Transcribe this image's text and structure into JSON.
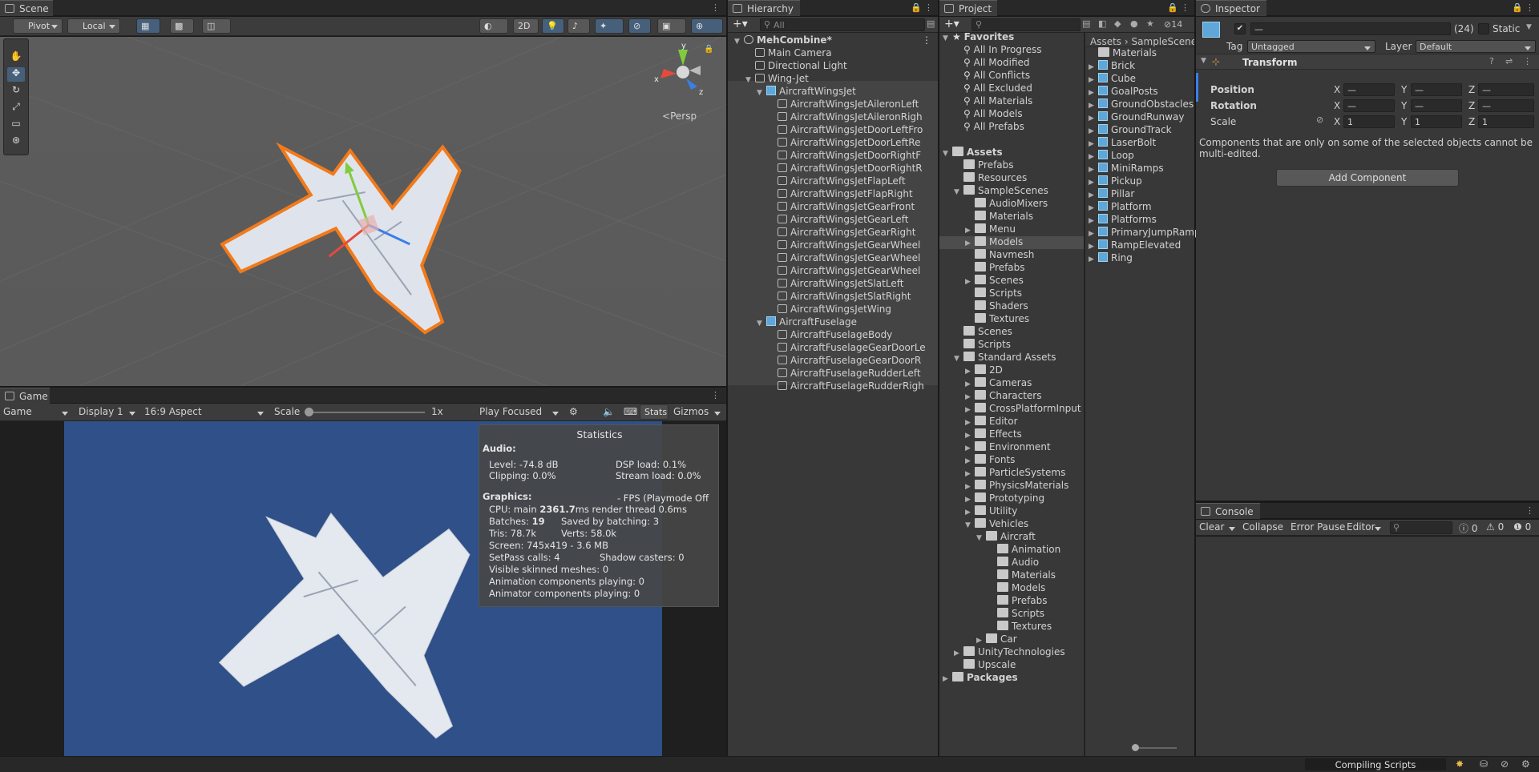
{
  "scene": {
    "tab_label": "Scene",
    "pivot_label": "Pivot",
    "local_label": "Local",
    "mode_2d_label": "2D",
    "persp_label": "Persp",
    "gizmo_axes": {
      "x": "x",
      "y": "y",
      "z": "z"
    }
  },
  "game": {
    "tab_label": "Game",
    "game_dropdown": "Game",
    "display_dropdown": "Display 1",
    "aspect_dropdown": "16:9 Aspect",
    "scale_label": "Scale",
    "scale_value": "1x",
    "play_focused_dropdown": "Play Focused",
    "stats_label": "Stats",
    "gizmos_label": "Gizmos",
    "stats_panel": {
      "title": "Statistics",
      "audio_header": "Audio:",
      "level": "Level: -74.8 dB",
      "clipping": "Clipping: 0.0%",
      "dsp_load": "DSP load: 0.1%",
      "stream_load": "Stream load: 0.0%",
      "graphics_header": "Graphics:",
      "fps": "- FPS (Playmode Off",
      "cpu_prefix": "CPU: main ",
      "cpu_main": "2361.7",
      "cpu_suffix": "ms  render thread 0.6ms",
      "batches_prefix": "Batches: ",
      "batches": "19",
      "saved_batching": "Saved by batching: 3",
      "tris": "Tris: 78.7k",
      "verts": "Verts: 58.0k",
      "screen": "Screen: 745x419 - 3.6 MB",
      "setpass": "SetPass calls: 4",
      "shadow_casters": "Shadow casters: 0",
      "skinned_meshes": "Visible skinned meshes: 0",
      "animation_components": "Animation components playing: 0",
      "animator_components": "Animator components playing: 0"
    }
  },
  "hierarchy": {
    "tab_label": "Hierarchy",
    "search_placeholder": "All",
    "items": [
      {
        "label": "MehCombine*",
        "depth": 0,
        "type": "scene",
        "expanded": true
      },
      {
        "label": "Main Camera",
        "depth": 1,
        "type": "object"
      },
      {
        "label": "Directional Light",
        "depth": 1,
        "type": "object"
      },
      {
        "label": "Wing-Jet",
        "depth": 1,
        "type": "object",
        "expanded": true
      },
      {
        "label": "AircraftWingsJet",
        "depth": 2,
        "type": "prefab",
        "expanded": true
      },
      {
        "label": "AircraftWingsJetAileronLeft",
        "depth": 3,
        "type": "object"
      },
      {
        "label": "AircraftWingsJetAileronRigh",
        "depth": 3,
        "type": "object"
      },
      {
        "label": "AircraftWingsJetDoorLeftFro",
        "depth": 3,
        "type": "object"
      },
      {
        "label": "AircraftWingsJetDoorLeftRe",
        "depth": 3,
        "type": "object"
      },
      {
        "label": "AircraftWingsJetDoorRightF",
        "depth": 3,
        "type": "object"
      },
      {
        "label": "AircraftWingsJetDoorRightR",
        "depth": 3,
        "type": "object"
      },
      {
        "label": "AircraftWingsJetFlapLeft",
        "depth": 3,
        "type": "object"
      },
      {
        "label": "AircraftWingsJetFlapRight",
        "depth": 3,
        "type": "object"
      },
      {
        "label": "AircraftWingsJetGearFront",
        "depth": 3,
        "type": "object"
      },
      {
        "label": "AircraftWingsJetGearLeft",
        "depth": 3,
        "type": "object"
      },
      {
        "label": "AircraftWingsJetGearRight",
        "depth": 3,
        "type": "object"
      },
      {
        "label": "AircraftWingsJetGearWheel",
        "depth": 3,
        "type": "object"
      },
      {
        "label": "AircraftWingsJetGearWheel",
        "depth": 3,
        "type": "object"
      },
      {
        "label": "AircraftWingsJetGearWheel",
        "depth": 3,
        "type": "object"
      },
      {
        "label": "AircraftWingsJetSlatLeft",
        "depth": 3,
        "type": "object"
      },
      {
        "label": "AircraftWingsJetSlatRight",
        "depth": 3,
        "type": "object"
      },
      {
        "label": "AircraftWingsJetWing",
        "depth": 3,
        "type": "object"
      },
      {
        "label": "AircraftFuselage",
        "depth": 2,
        "type": "prefab",
        "expanded": true
      },
      {
        "label": "AircraftFuselageBody",
        "depth": 3,
        "type": "object"
      },
      {
        "label": "AircraftFuselageGearDoorLe",
        "depth": 3,
        "type": "object"
      },
      {
        "label": "AircraftFuselageGearDoorR",
        "depth": 3,
        "type": "object"
      },
      {
        "label": "AircraftFuselageRudderLeft",
        "depth": 3,
        "type": "object"
      },
      {
        "label": "AircraftFuselageRudderRigh",
        "depth": 3,
        "type": "object"
      }
    ]
  },
  "project": {
    "tab_label": "Project",
    "hidden_count": "14",
    "breadcrumb_root": "Assets",
    "breadcrumb_sep": "›",
    "breadcrumb_current": "SampleScene",
    "tree": [
      {
        "label": "Favorites",
        "depth": 0,
        "type": "star",
        "expanded": true,
        "bold": true
      },
      {
        "label": "All In Progress",
        "depth": 1,
        "type": "search"
      },
      {
        "label": "All Modified",
        "depth": 1,
        "type": "search"
      },
      {
        "label": "All Conflicts",
        "depth": 1,
        "type": "search"
      },
      {
        "label": "All Excluded",
        "depth": 1,
        "type": "search"
      },
      {
        "label": "All Materials",
        "depth": 1,
        "type": "search"
      },
      {
        "label": "All Models",
        "depth": 1,
        "type": "search"
      },
      {
        "label": "All Prefabs",
        "depth": 1,
        "type": "search"
      },
      {
        "label": "",
        "depth": 0,
        "type": "spacer"
      },
      {
        "label": "Assets",
        "depth": 0,
        "type": "folder",
        "expanded": true,
        "bold": true
      },
      {
        "label": "Prefabs",
        "depth": 1,
        "type": "folder"
      },
      {
        "label": "Resources",
        "depth": 1,
        "type": "folder"
      },
      {
        "label": "SampleScenes",
        "depth": 1,
        "type": "folder",
        "expanded": true
      },
      {
        "label": "AudioMixers",
        "depth": 2,
        "type": "folder"
      },
      {
        "label": "Materials",
        "depth": 2,
        "type": "folder"
      },
      {
        "label": "Menu",
        "depth": 2,
        "type": "folder",
        "collapsed": true
      },
      {
        "label": "Models",
        "depth": 2,
        "type": "folder",
        "collapsed": true,
        "selected": true
      },
      {
        "label": "Navmesh",
        "depth": 2,
        "type": "folder"
      },
      {
        "label": "Prefabs",
        "depth": 2,
        "type": "folder"
      },
      {
        "label": "Scenes",
        "depth": 2,
        "type": "folder",
        "collapsed": true
      },
      {
        "label": "Scripts",
        "depth": 2,
        "type": "folder"
      },
      {
        "label": "Shaders",
        "depth": 2,
        "type": "folder"
      },
      {
        "label": "Textures",
        "depth": 2,
        "type": "folder"
      },
      {
        "label": "Scenes",
        "depth": 1,
        "type": "folder"
      },
      {
        "label": "Scripts",
        "depth": 1,
        "type": "folder"
      },
      {
        "label": "Standard Assets",
        "depth": 1,
        "type": "folder",
        "expanded": true
      },
      {
        "label": "2D",
        "depth": 2,
        "type": "folder",
        "collapsed": true
      },
      {
        "label": "Cameras",
        "depth": 2,
        "type": "folder",
        "collapsed": true
      },
      {
        "label": "Characters",
        "depth": 2,
        "type": "folder",
        "collapsed": true
      },
      {
        "label": "CrossPlatformInput",
        "depth": 2,
        "type": "folder",
        "collapsed": true
      },
      {
        "label": "Editor",
        "depth": 2,
        "type": "folder",
        "collapsed": true
      },
      {
        "label": "Effects",
        "depth": 2,
        "type": "folder",
        "collapsed": true
      },
      {
        "label": "Environment",
        "depth": 2,
        "type": "folder",
        "collapsed": true
      },
      {
        "label": "Fonts",
        "depth": 2,
        "type": "folder",
        "collapsed": true
      },
      {
        "label": "ParticleSystems",
        "depth": 2,
        "type": "folder",
        "collapsed": true
      },
      {
        "label": "PhysicsMaterials",
        "depth": 2,
        "type": "folder",
        "collapsed": true
      },
      {
        "label": "Prototyping",
        "depth": 2,
        "type": "folder",
        "collapsed": true
      },
      {
        "label": "Utility",
        "depth": 2,
        "type": "folder",
        "collapsed": true
      },
      {
        "label": "Vehicles",
        "depth": 2,
        "type": "folder",
        "expanded": true
      },
      {
        "label": "Aircraft",
        "depth": 3,
        "type": "folder",
        "expanded": true
      },
      {
        "label": "Animation",
        "depth": 4,
        "type": "folder"
      },
      {
        "label": "Audio",
        "depth": 4,
        "type": "folder"
      },
      {
        "label": "Materials",
        "depth": 4,
        "type": "folder"
      },
      {
        "label": "Models",
        "depth": 4,
        "type": "folder"
      },
      {
        "label": "Prefabs",
        "depth": 4,
        "type": "folder"
      },
      {
        "label": "Scripts",
        "depth": 4,
        "type": "folder"
      },
      {
        "label": "Textures",
        "depth": 4,
        "type": "folder"
      },
      {
        "label": "Car",
        "depth": 3,
        "type": "folder",
        "collapsed": true
      },
      {
        "label": "UnityTechnologies",
        "depth": 1,
        "type": "folder",
        "collapsed": true
      },
      {
        "label": "Upscale",
        "depth": 1,
        "type": "folder"
      },
      {
        "label": "Packages",
        "depth": 0,
        "type": "folder",
        "collapsed": true,
        "bold": true
      }
    ],
    "assets": [
      {
        "label": "Materials",
        "type": "folder"
      },
      {
        "label": "Brick",
        "type": "prefab"
      },
      {
        "label": "Cube",
        "type": "prefab"
      },
      {
        "label": "GoalPosts",
        "type": "prefab"
      },
      {
        "label": "GroundObstacles",
        "type": "prefab"
      },
      {
        "label": "GroundRunway",
        "type": "prefab"
      },
      {
        "label": "GroundTrack",
        "type": "prefab"
      },
      {
        "label": "LaserBolt",
        "type": "prefab"
      },
      {
        "label": "Loop",
        "type": "prefab"
      },
      {
        "label": "MiniRamps",
        "type": "prefab"
      },
      {
        "label": "Pickup",
        "type": "prefab"
      },
      {
        "label": "Pillar",
        "type": "prefab"
      },
      {
        "label": "Platform",
        "type": "prefab"
      },
      {
        "label": "Platforms",
        "type": "prefab"
      },
      {
        "label": "PrimaryJumpRamp",
        "type": "prefab"
      },
      {
        "label": "RampElevated",
        "type": "prefab"
      },
      {
        "label": "Ring",
        "type": "prefab"
      }
    ]
  },
  "inspector": {
    "tab_label": "Inspector",
    "name_value": "—",
    "count": "(24)",
    "static_label": "Static",
    "tag_label": "Tag",
    "tag_value": "Untagged",
    "layer_label": "Layer",
    "layer_value": "Default",
    "transform_title": "Transform",
    "position_label": "Position",
    "rotation_label": "Rotation",
    "scale_label": "Scale",
    "axis_x": "X",
    "axis_y": "Y",
    "axis_z": "Z",
    "position_values": [
      "—",
      "—",
      "—"
    ],
    "rotation_values": [
      "—",
      "—",
      "—"
    ],
    "scale_values": [
      "1",
      "1",
      "1"
    ],
    "multi_edit_note": "Components that are only on some of the selected objects cannot be multi-edited.",
    "add_component_label": "Add Component"
  },
  "console": {
    "tab_label": "Console",
    "clear_label": "Clear",
    "collapse_label": "Collapse",
    "error_pause_label": "Error Pause",
    "editor_dropdown": "Editor",
    "info_count": "0",
    "warning_count": "0",
    "error_count": "0"
  },
  "status_bar": {
    "compiling_label": "Compiling Scripts"
  },
  "colors": {
    "outline_orange": "#f27a1a",
    "game_bg": "#2f5088",
    "scene_bg": "#585858",
    "selection": "#2c5d87",
    "folder": "#c9a94c",
    "prefab": "#5fa7d8"
  }
}
